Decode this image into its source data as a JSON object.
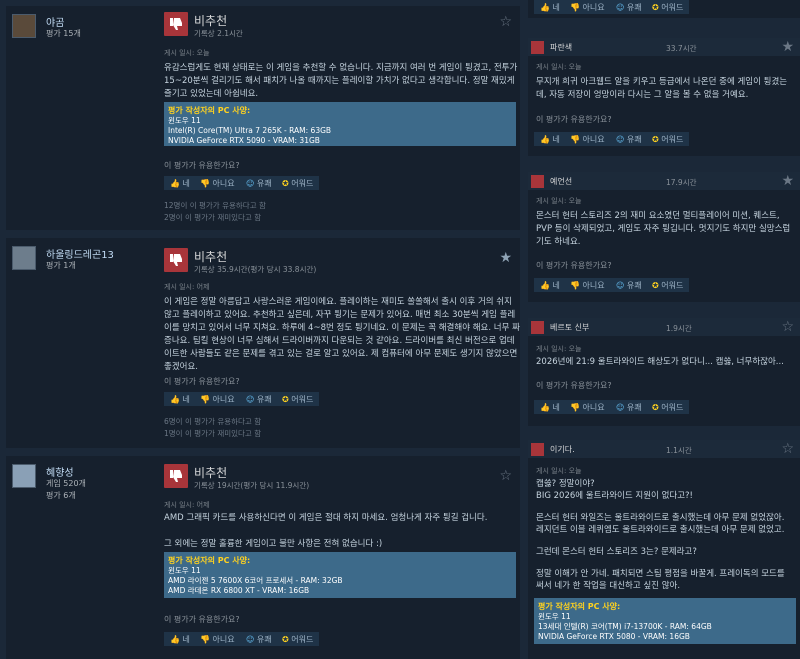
{
  "left_reviews": [
    {
      "user": "야곰",
      "games": "평가 15개",
      "products": "",
      "verdict": "비추천",
      "hours": "기록상 2.1시간",
      "posted": "게시 일시: 오늘",
      "body": [
        "유감스럽게도 현재 상태로는 이 게임을 추천할 수 없습니다. 지금까지 여러 번 게임이 튕겼고, 전투가",
        "15~20분씩 걸리기도 해서 패치가 나올 때까지는 플레이할 가치가 없다고 생각합니다. 정말 재밌게",
        "즐기고 있었는데 아쉽네요."
      ],
      "spec": {
        "heading": "평가 작성자의 PC 사양:",
        "lines": [
          "윈도우 11",
          "Intel(R) Core(TM) Ultra 7 265K - RAM: 63GB",
          "NVIDIA GeForce RTX 5090 - VRAM: 31GB"
        ]
      },
      "helpful_q": "이 평가가 유용한가요?",
      "counts": [
        "12명이 이 평가가 유용하다고 함",
        "2명이 이 평가가 재미있다고 함"
      ]
    },
    {
      "user": "하울링드레곤13",
      "games": "평가 1개",
      "products": "",
      "verdict": "비추천",
      "hours": "기록상 35.9시간(평가 당시 33.8시간)",
      "posted": "게시 일시: 어제",
      "body": [
        "이 게임은 정말 아름답고 사랑스러운 게임이에요. 플레이하는 재미도 쏠쏠해서 출시 이후 거의 쉬지",
        "않고 플레이하고 있어요. 추천하고 싶은데, 자꾸 튕기는 문제가 있어요. 매번 최소 30분씩 게임 플레",
        "이를 망치고 있어서 너무 지쳐요. 하루에 4~8번 정도 튕기네요. 이 문제는 꼭 해결해야 해요. 너무 짜",
        "증나요. 팀킬 현상이 너무 심해서 드라이버까지 다운되는 것 같아요. 드라이버를 최신 버전으로 업데",
        "이트한 사람들도 같은 문제를 겪고 있는 걸로 알고 있어요. 제 컴퓨터에 아무 문제도 생기지 않았으면",
        "좋겠어요."
      ],
      "spec": null,
      "helpful_q": "이 평가가 유용한가요?",
      "counts": [
        "6명이 이 평가가 유용하다고 함",
        "1명이 이 평가가 재미있다고 함"
      ]
    },
    {
      "user": "혜향성",
      "games": "게임 520개",
      "products": "평가 6개",
      "verdict": "비추천",
      "hours": "기록상 19시간(평가 당시 11.9시간)",
      "posted": "게시 일시: 어제",
      "body": [
        "AMD 그래픽 카드를 사용하신다면 이 게임은 절대 하지 마세요. 엄청나게 자주 튕길 겁니다.",
        "",
        "그 외에는 정말 훌륭한 게임이고 불만 사항은 전혀 없습니다 :)"
      ],
      "spec": {
        "heading": "평가 작성자의 PC 사양:",
        "lines": [
          "윈도우 11",
          "AMD 라이젠 5 7600X 6코어 프로세서 - RAM: 32GB",
          "AMD 라데온 RX 6800 XT - VRAM: 16GB"
        ]
      },
      "helpful_q": "이 평가가 유용한가요?",
      "counts": []
    }
  ],
  "buttons": {
    "yes": "네",
    "no": "아니요",
    "funny": "유쾌",
    "award": "어워드"
  },
  "right_reviews": [
    {
      "user": "",
      "hours": "",
      "posted": "",
      "body": [],
      "helpful_q": "",
      "spec": null
    },
    {
      "user": "파란색",
      "hours": "33.7시간",
      "posted": "게시 일시: 오늘",
      "body": [
        "무지개 희귀 아크웹드 알을 키우고 등급에서 나온던 중에 게임이 튕겼는",
        "데, 자동 저장이 엉망이라 다시는 그 알을 볼 수 없을 거예요."
      ],
      "helpful_q": "이 평가가 유용한가요?",
      "spec": null
    },
    {
      "user": "예언선",
      "hours": "17.9시간",
      "posted": "게시 일시: 오늘",
      "body": [
        "몬스터 헌터 스토리즈 2의 재미 요소였던 멀티플레이어 미션, 퀘스트,",
        "PVP 등이 삭제되었고, 게임도 자주 튕깁니다. 멋지기도 하지만 실망스럽",
        "기도 하네요."
      ],
      "helpful_q": "이 평가가 유용한가요?",
      "spec": null
    },
    {
      "user": "베르토 신부",
      "hours": "1.9시간",
      "posted": "게시 일시: 오늘",
      "body": [
        "2026년에 21:9 울트라와이드 해상도가 없다니... 캡쓿, 너무하잖아..."
      ],
      "helpful_q": "",
      "spec": null
    },
    {
      "user": "이기다.",
      "hours": "1.1시간",
      "posted": "게시 일시: 오늘",
      "body": [
        "캡쓿? 정말이야?",
        "BIG 2026에 울트라와이드 지원이 없다고?!",
        "",
        "몬스터 헌터 와일즈는 울트라와이드로 출시했는데 아무 문제 없었잖아.",
        "레지던트 이블 레퀴엠도 울트라와이드로 출시했는데 아무 문제 없었고.",
        "",
        "그런데 몬스터 헌터 스토리즈 3는? 문제라고?",
        "",
        "정말 이해가 안 가네. 패치되면 스팀 평점을 바꿀게. 프레이독의 모드를",
        "써서 네가 한 작업을 대신하고 싶진 않아."
      ],
      "helpful_q": "",
      "spec": {
        "heading": "평가 작성자의 PC 사양:",
        "lines": [
          "윈도우 11",
          "13세대 인텔(R) 코어(TM) i7-13700K - RAM: 64GB",
          "NVIDIA GeForce RTX 5080 - VRAM: 16GB"
        ]
      }
    }
  ]
}
